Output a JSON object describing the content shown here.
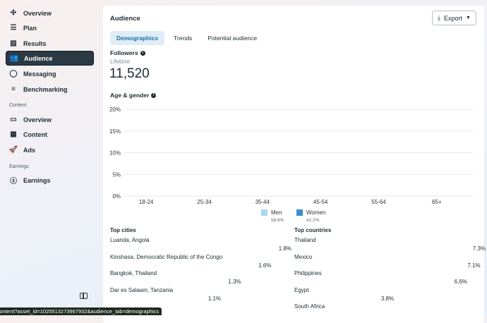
{
  "sidebar": {
    "items": [
      {
        "label": "Overview",
        "icon": "overview-icon"
      },
      {
        "label": "Plan",
        "icon": "list-icon"
      },
      {
        "label": "Results",
        "icon": "chart-icon"
      },
      {
        "label": "Audience",
        "icon": "people-icon",
        "active": true
      },
      {
        "label": "Messaging",
        "icon": "chat-icon"
      },
      {
        "label": "Benchmarking",
        "icon": "benchmark-icon"
      }
    ],
    "content_section": "Content",
    "content_items": [
      {
        "label": "Overview",
        "icon": "monitor-icon"
      },
      {
        "label": "Content",
        "icon": "grid-icon"
      },
      {
        "label": "Ads",
        "icon": "rocket-icon"
      }
    ],
    "earnings_section": "Earnings",
    "earnings_items": [
      {
        "label": "Earnings",
        "icon": "dollar-icon"
      }
    ]
  },
  "header": {
    "title": "Audience",
    "export_label": "Export"
  },
  "tabs": [
    "Demographics",
    "Trends",
    "Potential audience"
  ],
  "followers": {
    "label": "Followers",
    "period": "Lifetime",
    "count": "11,520"
  },
  "age_gender_label": "Age & gender",
  "chart_data": {
    "type": "bar",
    "categories": [
      "18-24",
      "25-34",
      "35-44",
      "45-54",
      "55-64",
      "65+"
    ],
    "yticks": [
      "0%",
      "5%",
      "10%",
      "15%",
      "20%"
    ],
    "ylim": [
      0,
      20
    ],
    "series": [
      {
        "name": "Men",
        "share": "58.8%",
        "color": "#a6d8f5",
        "values": []
      },
      {
        "name": "Women",
        "share": "41.2%",
        "color": "#3a8ecb",
        "values": []
      }
    ],
    "grid": true,
    "legend": "bottom"
  },
  "top_cities": {
    "title": "Top cities",
    "rows": [
      {
        "name": "Luanda, Angola",
        "pct": "1.8%",
        "value": 1.8
      },
      {
        "name": "Kinshasa, Democratic Republic of the Congo",
        "pct": "1.6%",
        "value": 1.6
      },
      {
        "name": "Bangkok, Thailand",
        "pct": "1.3%",
        "value": 1.3
      },
      {
        "name": "Dar es Salaam, Tanzania",
        "pct": "1.1%",
        "value": 1.1
      }
    ]
  },
  "top_countries": {
    "title": "Top countries",
    "rows": [
      {
        "name": "Thailand",
        "pct": "7.3%",
        "value": 7.3
      },
      {
        "name": "Mexico",
        "pct": "7.1%",
        "value": 7.1
      },
      {
        "name": "Philippines",
        "pct": "6.6%",
        "value": 6.6
      },
      {
        "name": "Egypt",
        "pct": "3.8%",
        "value": 3.8
      },
      {
        "name": "South Africa",
        "pct": "",
        "value": null
      }
    ]
  },
  "status_url": "ghts/content?asset_id=1025513273967932&audience_tab=demographics"
}
